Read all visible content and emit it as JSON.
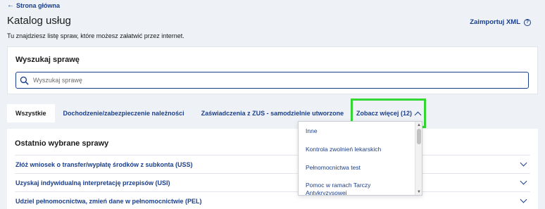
{
  "header": {
    "back_link": "Strona główna",
    "title": "Katalog usług",
    "import_link": "Zaimportuj XML",
    "subtitle": "Tu znajdziesz listę spraw, które możesz załatwić przez internet."
  },
  "search": {
    "heading": "Wyszukaj sprawę",
    "placeholder": "Wyszukaj sprawę",
    "value": ""
  },
  "tabs": {
    "items": [
      {
        "label": "Wszystkie"
      },
      {
        "label": "Dochodzenie/zabezpieczenie należności"
      },
      {
        "label": "Zaświadczenia z ZUS - samodzielnie utworzone"
      }
    ],
    "more_label": "Zobacz więcej (12)"
  },
  "dropdown": {
    "items": [
      {
        "label": "Inne"
      },
      {
        "label": "Kontrola zwolnień lekarskich"
      },
      {
        "label": "Pełnomocnictwa test"
      },
      {
        "label": "Pomoc w ramach Tarczy Antykryzysowej"
      }
    ]
  },
  "recent": {
    "heading": "Ostatnio wybrane sprawy",
    "items": [
      {
        "label": "Złóż wniosek o transfer/wypłatę środków z subkonta (USS)"
      },
      {
        "label": "Uzyskaj indywidualną interpretację przepisów (USI)"
      },
      {
        "label": "Udziel pełnomocnictwa, zmień dane w pełnomocnictwie (PEL)"
      }
    ]
  },
  "colors": {
    "link": "#1b3f8b",
    "background": "#eef1f5",
    "highlight": "#33d633"
  }
}
